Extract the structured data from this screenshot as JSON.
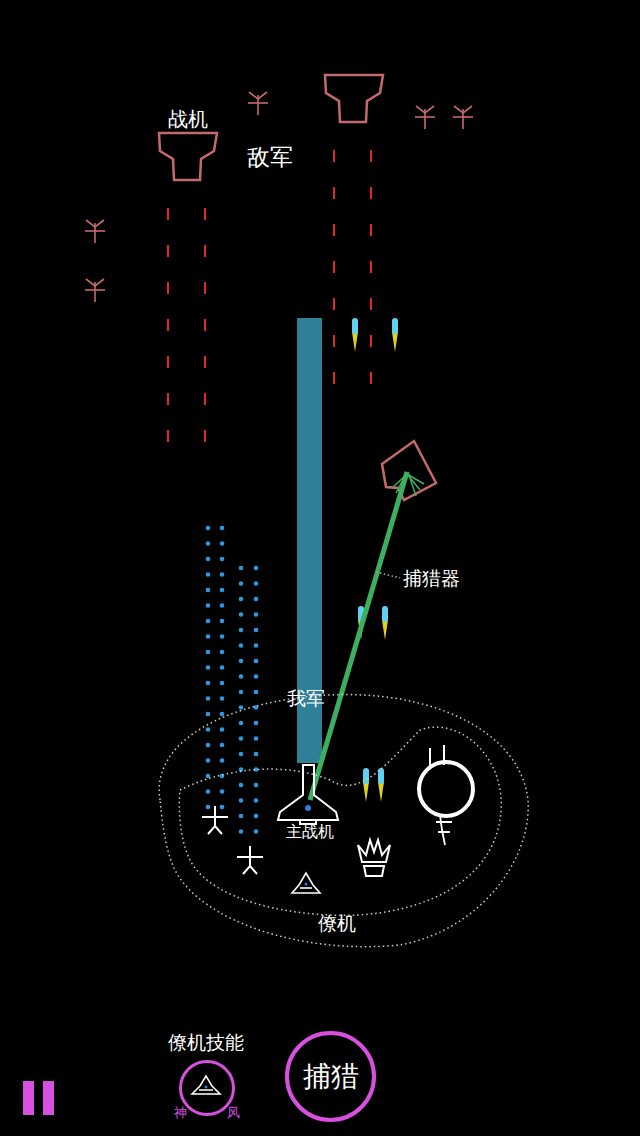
{
  "enemy": {
    "title": "敌军",
    "fighter_label": "战机"
  },
  "hunter_label": "捕猎器",
  "ally": {
    "title": "我军",
    "main_fighter_label": "主战机",
    "wingman_label": "僚机"
  },
  "controls": {
    "wingman_skill": {
      "title": "僚机技能",
      "left": "神",
      "right": "风"
    },
    "hunt_button": {
      "label": "捕猎"
    }
  }
}
